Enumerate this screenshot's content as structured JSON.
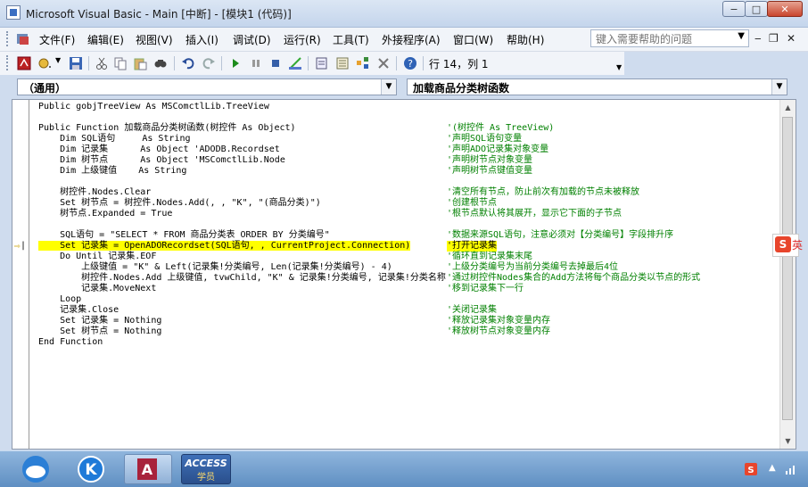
{
  "window": {
    "title": "Microsoft Visual Basic - Main [中断] - [模块1 (代码)]",
    "buttons": [
      "−",
      "□",
      "✕"
    ]
  },
  "menu": {
    "items": [
      "文件(F)",
      "编辑(E)",
      "视图(V)",
      "插入(I)",
      "调试(D)",
      "运行(R)",
      "工具(T)",
      "外接程序(A)",
      "窗口(W)",
      "帮助(H)"
    ]
  },
  "help": {
    "placeholder": "键入需要帮助的问题"
  },
  "mdi_buttons": [
    "‒",
    "❐",
    "✕"
  ],
  "status": {
    "position": "行 14，列 1"
  },
  "combos": {
    "object": "（通用）",
    "procedure": "加载商品分类树函数"
  },
  "code": {
    "lines": [
      {
        "code": "Public gobjTreeView As MSComctlLib.TreeView",
        "comment": ""
      },
      {
        "code": "",
        "comment": ""
      },
      {
        "code": "Public Function 加载商品分类树函数(树控件 As Object)",
        "comment": "'(树控件 As TreeView)"
      },
      {
        "code": "    Dim SQL语句     As String",
        "comment": "'声明SQL语句变量"
      },
      {
        "code": "    Dim 记录集      As Object 'ADODB.Recordset",
        "comment": "'声明ADO记录集对象变量"
      },
      {
        "code": "    Dim 树节点      As Object 'MSComctlLib.Node",
        "comment": "'声明树节点对象变量"
      },
      {
        "code": "    Dim 上级键值    As String",
        "comment": "'声明树节点键值变量"
      },
      {
        "code": "",
        "comment": ""
      },
      {
        "code": "    树控件.Nodes.Clear",
        "comment": "'清空所有节点，防止前次有加载的节点未被释放"
      },
      {
        "code": "    Set 树节点 = 树控件.Nodes.Add(, , \"K\", \"(商品分类)\")",
        "comment": "'创建根节点"
      },
      {
        "code": "    树节点.Expanded = True",
        "comment": "'根节点默认将其展开，显示它下面的子节点"
      },
      {
        "code": "",
        "comment": ""
      },
      {
        "code": "    SQL语句 = \"SELECT * FROM 商品分类表 ORDER BY 分类编号\"",
        "comment": "'数据来源SQL语句，注意必须对【分类编号】字段排升序"
      },
      {
        "code": "    Set 记录集 = OpenADORecordset(SQL语句, , CurrentProject.Connection)",
        "comment": "'打开记录集",
        "highlight": true
      },
      {
        "code": "    Do Until 记录集.EOF",
        "comment": "'循环直到记录集末尾"
      },
      {
        "code": "        上级键值 = \"K\" & Left(记录集!分类编号, Len(记录集!分类编号) - 4)",
        "comment": "'上级分类编号为当前分类编号去掉最后4位"
      },
      {
        "code": "        树控件.Nodes.Add 上级键值, tvwChild, \"K\" & 记录集!分类编号, 记录集!分类名称",
        "comment": "'通过树控件Nodes集合的Add方法将每个商品分类以节点的形式"
      },
      {
        "code": "        记录集.MoveNext",
        "comment": "'移到记录集下一行"
      },
      {
        "code": "    Loop",
        "comment": ""
      },
      {
        "code": "    记录集.Close",
        "comment": "'关闭记录集"
      },
      {
        "code": "    Set 记录集 = Nothing",
        "comment": "'释放记录集对象变量内存"
      },
      {
        "code": "    Set 树节点 = Nothing",
        "comment": "'释放树节点对象变量内存"
      },
      {
        "code": "End Function",
        "comment": ""
      }
    ]
  },
  "ime": {
    "logo": "S",
    "text": "英"
  },
  "taskbar": {
    "access_label": "ACCESS",
    "access_sub": "学员"
  }
}
